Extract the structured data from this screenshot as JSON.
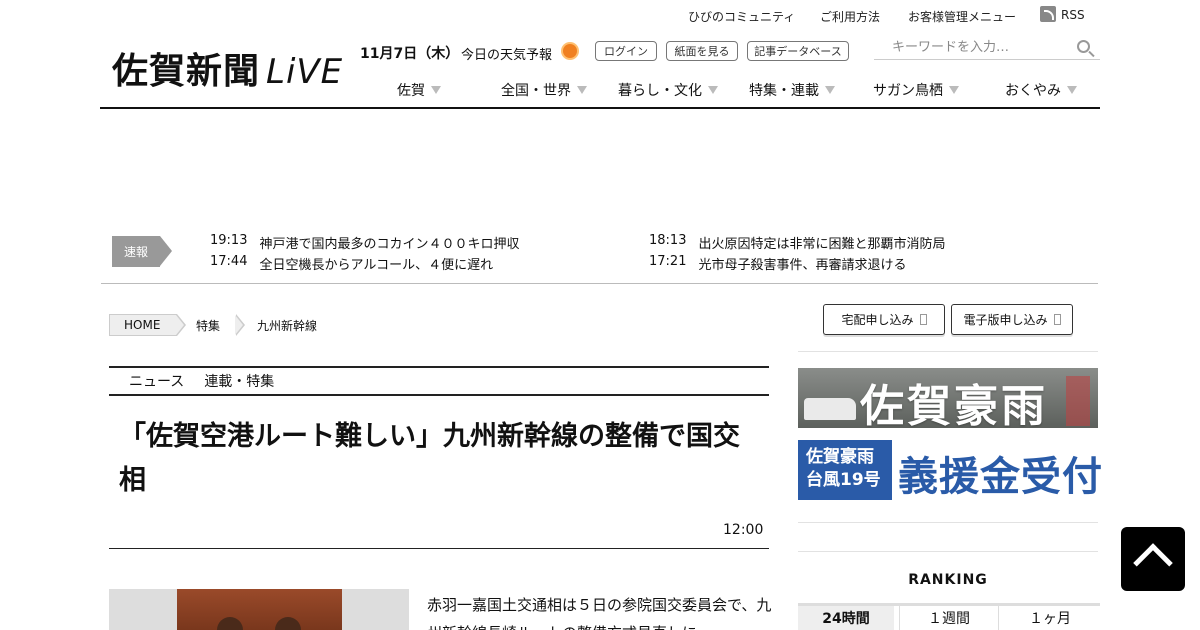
{
  "header": {
    "top_links": [
      "ひびのコミュニティ",
      "ご利用方法",
      "お客様管理メニュー"
    ],
    "rss_label": "RSS",
    "logo_text": "佐賀新聞",
    "logo_live": "LiVE",
    "date": "11月7日（木）",
    "weather_label": "今日の天気予報",
    "buttons": [
      "ログイン",
      "紙面を見る",
      "記事データベース"
    ],
    "search_placeholder": "キーワードを入力…"
  },
  "nav": {
    "items": [
      "佐賀",
      "全国・世界",
      "暮らし・文化",
      "特集・連載",
      "サガン鳥栖",
      "おくやみ"
    ]
  },
  "breaking": {
    "tag": "速報",
    "items": [
      {
        "time": "19:13",
        "text": "神戸港で国内最多のコカイン４００キロ押収"
      },
      {
        "time": "17:44",
        "text": "全日空機長からアルコール、４便に遅れ"
      },
      {
        "time": "18:13",
        "text": "出火原因特定は非常に困難と那覇市消防局"
      },
      {
        "time": "17:21",
        "text": "光市母子殺害事件、再審請求退ける"
      }
    ]
  },
  "breadcrumb": [
    "HOME",
    "特集",
    "九州新幹線"
  ],
  "side_buttons": [
    "宅配申し込み",
    "電子版申し込み"
  ],
  "article": {
    "sections": [
      "ニュース",
      "連載・特集"
    ],
    "headline": "「佐賀空港ルート難しい」九州新幹線の整備で国交相",
    "time": "12:00",
    "body": "赤羽一嘉国土交通相は５日の参院国交委員会で、九州新幹線長崎ルートの整備方式見直しに"
  },
  "sidebar": {
    "banner1_text": "佐賀豪雨",
    "banner2_left": "佐賀豪雨\n台風19号",
    "banner2_right": "義援金受付",
    "ranking_title": "RANKING",
    "ranking_tabs": [
      "24時間",
      "１週間",
      "１ヶ月"
    ]
  },
  "icons": [
    "rss-icon",
    "sun-icon",
    "search-icon",
    "dropdown-triangle-icon",
    "back-to-top-icon"
  ],
  "colors": {
    "accent": "#2a5ba8",
    "breaking_tag": "#999999",
    "text": "#111111"
  }
}
